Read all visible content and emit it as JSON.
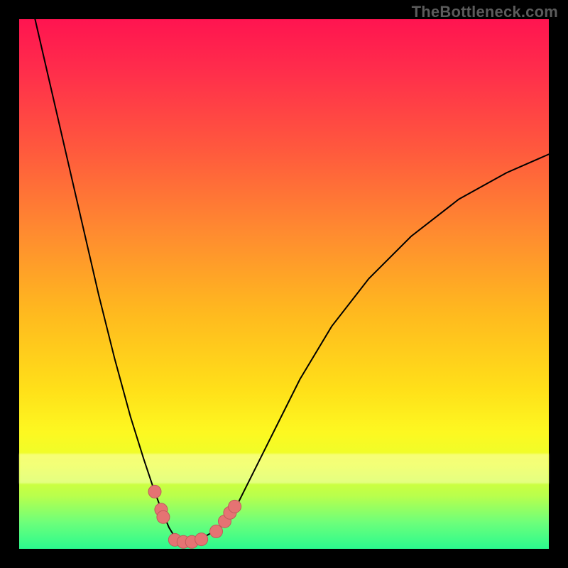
{
  "watermark": "TheBottleneck.com",
  "chart_data": {
    "type": "line",
    "title": "",
    "xlabel": "",
    "ylabel": "",
    "xlim": [
      0,
      1
    ],
    "ylim": [
      0,
      1
    ],
    "grid": false,
    "legend": false,
    "series": [
      {
        "name": "curve",
        "x": [
          0.03,
          0.06,
          0.09,
          0.12,
          0.15,
          0.18,
          0.21,
          0.235,
          0.255,
          0.27,
          0.283,
          0.294,
          0.305,
          0.32,
          0.345,
          0.38,
          0.41,
          0.44,
          0.48,
          0.53,
          0.59,
          0.66,
          0.74,
          0.83,
          0.92,
          1.0
        ],
        "y": [
          1.0,
          0.87,
          0.74,
          0.61,
          0.48,
          0.36,
          0.25,
          0.17,
          0.11,
          0.07,
          0.04,
          0.022,
          0.015,
          0.015,
          0.02,
          0.04,
          0.08,
          0.14,
          0.22,
          0.32,
          0.42,
          0.51,
          0.59,
          0.66,
          0.71,
          0.745
        ]
      }
    ],
    "markers": [
      {
        "x": 0.256,
        "y": 0.108
      },
      {
        "x": 0.268,
        "y": 0.074
      },
      {
        "x": 0.272,
        "y": 0.06
      },
      {
        "x": 0.294,
        "y": 0.017
      },
      {
        "x": 0.31,
        "y": 0.013
      },
      {
        "x": 0.326,
        "y": 0.013
      },
      {
        "x": 0.344,
        "y": 0.018
      },
      {
        "x": 0.372,
        "y": 0.033
      },
      {
        "x": 0.388,
        "y": 0.052
      },
      {
        "x": 0.398,
        "y": 0.068
      },
      {
        "x": 0.407,
        "y": 0.08
      }
    ],
    "colors": {
      "gradient_top": "#ff1450",
      "gradient_bottom": "#2bfa8e",
      "curve_stroke": "#000000",
      "marker_fill": "#e57373",
      "frame": "#000000"
    }
  }
}
